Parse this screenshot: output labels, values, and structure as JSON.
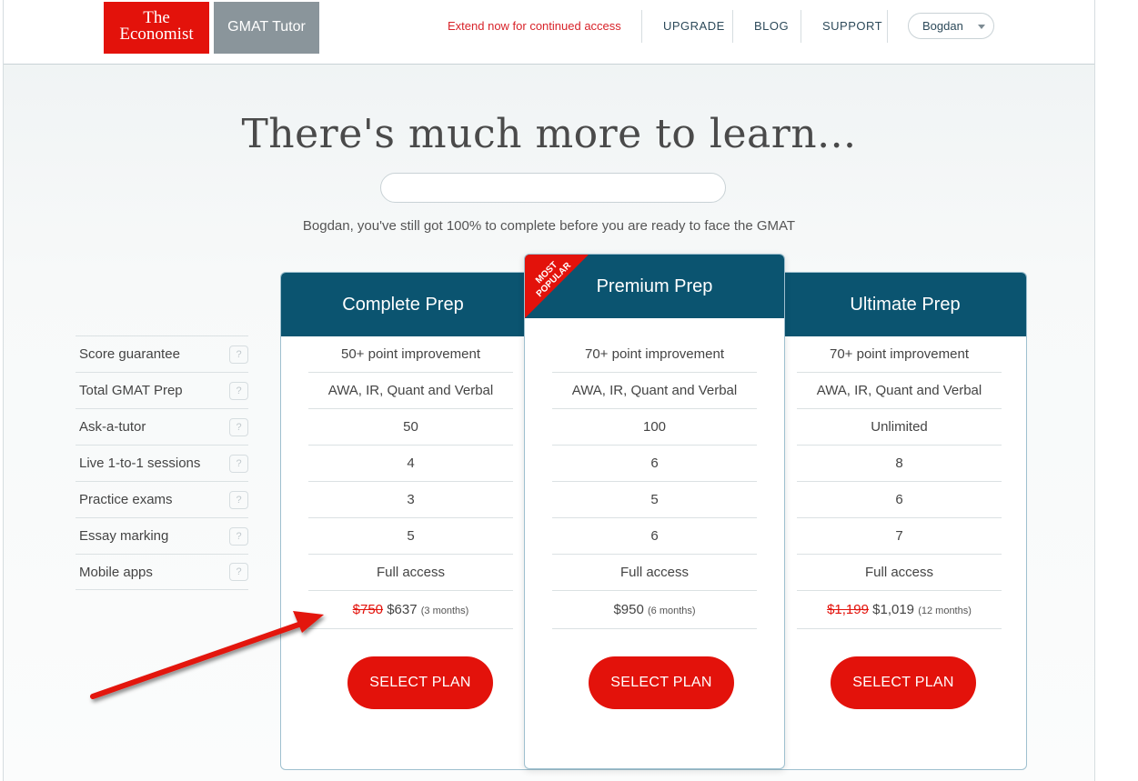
{
  "header": {
    "logo_line1": "The",
    "logo_line2": "Economist",
    "product_label": "GMAT Tutor",
    "extend_notice": "Extend now for continued access",
    "nav": [
      "UPGRADE",
      "BLOG",
      "SUPPORT"
    ],
    "user_name": "Bogdan"
  },
  "hero": {
    "title": "There's much more to learn...",
    "progress_percent": 0,
    "subtitle": "Bogdan, you've still got 100% to complete before you are ready to face the GMAT"
  },
  "features": [
    "Score guarantee",
    "Total GMAT Prep",
    "Ask-a-tutor",
    "Live 1-to-1 sessions",
    "Practice exams",
    "Essay marking",
    "Mobile apps"
  ],
  "help_icon": "?",
  "plans": [
    {
      "name": "Complete Prep",
      "values": [
        "50+ point improvement",
        "AWA, IR, Quant and Verbal",
        "50",
        "4",
        "3",
        "5",
        "Full access"
      ],
      "old_price": "$750",
      "price": "$637",
      "term": "(3 months)",
      "button": "SELECT PLAN"
    },
    {
      "name": "Premium Prep",
      "badge": "MOST POPULAR",
      "values": [
        "70+ point improvement",
        "AWA, IR, Quant and Verbal",
        "100",
        "6",
        "5",
        "6",
        "Full access"
      ],
      "old_price": "",
      "price": "$950",
      "term": "(6 months)",
      "button": "SELECT PLAN"
    },
    {
      "name": "Ultimate Prep",
      "values": [
        "70+ point improvement",
        "AWA, IR, Quant and Verbal",
        "Unlimited",
        "8",
        "6",
        "7",
        "Full access"
      ],
      "old_price": "$1,199",
      "price": "$1,019",
      "term": "(12 months)",
      "button": "SELECT PLAN"
    }
  ],
  "colors": {
    "brand_red": "#e3120b",
    "header_teal": "#0b5470",
    "logo_grey": "#8a959b"
  }
}
